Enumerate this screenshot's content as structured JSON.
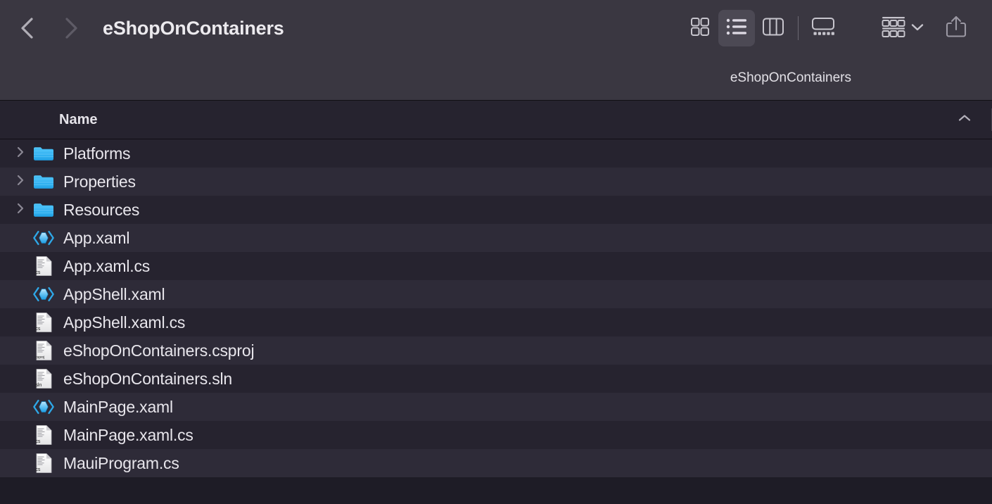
{
  "window": {
    "title": "eShopOnContainers",
    "subtitle": "eShopOnContainers"
  },
  "toolbar": {
    "back_label": "Back",
    "forward_label": "Forward",
    "back_icon": "chevron-left-icon",
    "forward_icon": "chevron-right-icon",
    "view_buttons": [
      {
        "name": "icon-view",
        "label": "Icon View",
        "icon": "grid-icon",
        "active": false
      },
      {
        "name": "list-view",
        "label": "List View",
        "icon": "list-icon",
        "active": true
      },
      {
        "name": "column-view",
        "label": "Column View",
        "icon": "columns-icon",
        "active": false
      },
      {
        "name": "gallery-view",
        "label": "Gallery View",
        "icon": "gallery-icon",
        "active": false
      }
    ],
    "group_button": {
      "label": "Group",
      "icon": "group-icon",
      "chevron": "chevron-down-icon"
    },
    "share_button": {
      "label": "Share",
      "icon": "share-icon"
    }
  },
  "column_header": {
    "name_label": "Name",
    "sort_direction": "ascending",
    "sort_icon": "chevron-up-icon"
  },
  "files": [
    {
      "name": "Platforms",
      "type": "folder",
      "icon": "folder-icon",
      "ext": "",
      "expandable": true
    },
    {
      "name": "Properties",
      "type": "folder",
      "icon": "folder-icon",
      "ext": "",
      "expandable": true
    },
    {
      "name": "Resources",
      "type": "folder",
      "icon": "folder-icon",
      "ext": "",
      "expandable": true
    },
    {
      "name": "App.xaml",
      "type": "xaml",
      "icon": "xaml-icon",
      "ext": "",
      "expandable": false
    },
    {
      "name": "App.xaml.cs",
      "type": "doc",
      "icon": "csharp-icon",
      "ext": "cs",
      "expandable": false
    },
    {
      "name": "AppShell.xaml",
      "type": "xaml",
      "icon": "xaml-icon",
      "ext": "",
      "expandable": false
    },
    {
      "name": "AppShell.xaml.cs",
      "type": "doc",
      "icon": "csharp-icon",
      "ext": "cs",
      "expandable": false
    },
    {
      "name": "eShopOnContainers.csproj",
      "type": "doc",
      "icon": "csproj-icon",
      "ext": "csproj",
      "expandable": false
    },
    {
      "name": "eShopOnContainers.sln",
      "type": "doc",
      "icon": "sln-icon",
      "ext": "sln",
      "expandable": false
    },
    {
      "name": "MainPage.xaml",
      "type": "xaml",
      "icon": "xaml-icon",
      "ext": "",
      "expandable": false
    },
    {
      "name": "MainPage.xaml.cs",
      "type": "doc",
      "icon": "csharp-icon",
      "ext": "cs",
      "expandable": false
    },
    {
      "name": "MauiProgram.cs",
      "type": "doc",
      "icon": "csharp-icon",
      "ext": "cs",
      "expandable": false
    }
  ],
  "colors": {
    "toolbar_bg": "#3a3741",
    "row_odd_bg": "#26232f",
    "row_even_bg": "#2e2b38",
    "list_bg": "#1e1c26",
    "text": "#e8e6ec",
    "folder_blue": "#30b4f2",
    "xaml_blue": "#2ea8e8",
    "active_btn": "#4c4954"
  }
}
